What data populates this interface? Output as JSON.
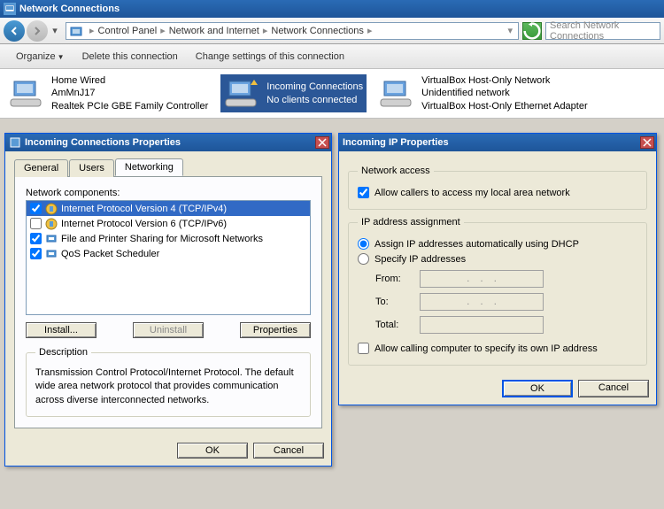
{
  "window": {
    "title": "Network Connections"
  },
  "breadcrumb": {
    "root": "Control Panel",
    "mid": "Network and Internet",
    "leaf": "Network Connections"
  },
  "search": {
    "placeholder": "Search Network Connections"
  },
  "toolbar": {
    "organize": "Organize",
    "delete": "Delete this connection",
    "change": "Change settings of this connection"
  },
  "connections": [
    {
      "name": "Home Wired",
      "line2": "AmMnJ17",
      "line3": "Realtek PCIe GBE Family Controller"
    },
    {
      "name": "Incoming Connections",
      "line2": "No clients connected",
      "line3": ""
    },
    {
      "name": "VirtualBox Host-Only Network",
      "line2": "Unidentified network",
      "line3": "VirtualBox Host-Only Ethernet Adapter"
    }
  ],
  "dlg1": {
    "title": "Incoming Connections Properties",
    "tabs": {
      "general": "General",
      "users": "Users",
      "networking": "Networking"
    },
    "components_label": "Network components:",
    "components": [
      {
        "label": "Internet Protocol Version 4 (TCP/IPv4)",
        "checked": true,
        "selected": true
      },
      {
        "label": "Internet Protocol Version 6 (TCP/IPv6)",
        "checked": false,
        "selected": false
      },
      {
        "label": "File and Printer Sharing for Microsoft Networks",
        "checked": true,
        "selected": false
      },
      {
        "label": "QoS Packet Scheduler",
        "checked": true,
        "selected": false
      }
    ],
    "buttons": {
      "install": "Install...",
      "uninstall": "Uninstall",
      "properties": "Properties"
    },
    "desc_label": "Description",
    "desc_text": "Transmission Control Protocol/Internet Protocol. The default wide area network protocol that provides communication across diverse interconnected networks.",
    "ok": "OK",
    "cancel": "Cancel"
  },
  "dlg2": {
    "title": "Incoming IP Properties",
    "group1": "Network access",
    "allow_callers": "Allow callers to access my local area network",
    "group2": "IP address assignment",
    "radio_dhcp": "Assign IP addresses automatically using DHCP",
    "radio_specify": "Specify IP addresses",
    "from": "From:",
    "to": "To:",
    "total": "Total:",
    "allow_calling": "Allow calling computer to specify its own IP address",
    "ok": "OK",
    "cancel": "Cancel"
  }
}
